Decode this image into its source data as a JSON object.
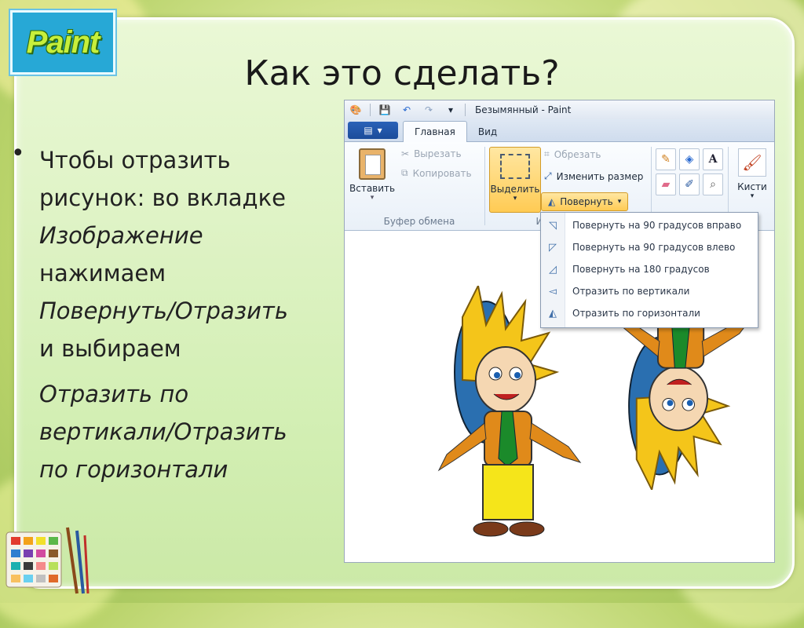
{
  "slide": {
    "title": "Как это сделать?",
    "logo_text": "Paint",
    "bullet_symbol": "•",
    "body": {
      "line1": "Чтобы отразить",
      "line2": "рисунок: во вкладке",
      "line3_italic": "Изображение",
      "line4": "нажимаем",
      "line5_italic": "Повернуть/Отразить",
      "line6": "и выбираем",
      "line7_italic": "Отразить по",
      "line8_italic": "вертикали/Отразить",
      "line9_italic": "по горизонтали"
    }
  },
  "paint": {
    "window_title": "Безымянный - Paint",
    "tabs": [
      "Главная",
      "Вид"
    ],
    "clipboard": {
      "paste_label": "Вставить",
      "cut_label": "Вырезать",
      "copy_label": "Копировать",
      "group_label": "Буфер обмена"
    },
    "image": {
      "crop_label": "Обрезать",
      "resize_label": "Изменить размер",
      "select_label": "Выделить",
      "rotate_label": "Повернуть",
      "group_label_fragment": "И"
    },
    "brushes_label": "Кисти",
    "rotate_menu": [
      {
        "label": "Повернуть на 90 градусов вправо",
        "icon": "rotate-right-icon"
      },
      {
        "label": "Повернуть на 90 градусов влево",
        "icon": "rotate-left-icon"
      },
      {
        "label": "Повернуть на 180 градусов",
        "icon": "rotate-180-icon"
      },
      {
        "label": "Отразить по вертикали",
        "icon": "flip-vertical-icon"
      },
      {
        "label": "Отразить по горизонтали",
        "icon": "flip-horizontal-icon"
      }
    ]
  },
  "colors": {
    "accent_select": "#ffcb54",
    "file_button": "#1b4c9a",
    "slide_border": "#ffffff"
  }
}
